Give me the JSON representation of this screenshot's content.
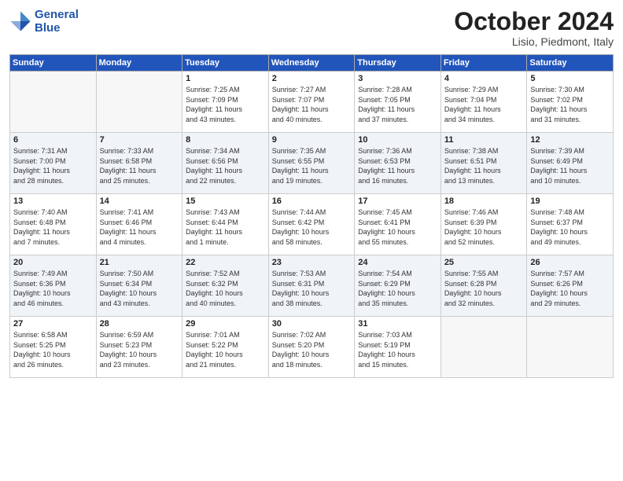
{
  "header": {
    "logo_line1": "General",
    "logo_line2": "Blue",
    "month": "October 2024",
    "location": "Lisio, Piedmont, Italy"
  },
  "weekdays": [
    "Sunday",
    "Monday",
    "Tuesday",
    "Wednesday",
    "Thursday",
    "Friday",
    "Saturday"
  ],
  "weeks": [
    [
      {
        "day": "",
        "info": ""
      },
      {
        "day": "",
        "info": ""
      },
      {
        "day": "1",
        "info": "Sunrise: 7:25 AM\nSunset: 7:09 PM\nDaylight: 11 hours\nand 43 minutes."
      },
      {
        "day": "2",
        "info": "Sunrise: 7:27 AM\nSunset: 7:07 PM\nDaylight: 11 hours\nand 40 minutes."
      },
      {
        "day": "3",
        "info": "Sunrise: 7:28 AM\nSunset: 7:05 PM\nDaylight: 11 hours\nand 37 minutes."
      },
      {
        "day": "4",
        "info": "Sunrise: 7:29 AM\nSunset: 7:04 PM\nDaylight: 11 hours\nand 34 minutes."
      },
      {
        "day": "5",
        "info": "Sunrise: 7:30 AM\nSunset: 7:02 PM\nDaylight: 11 hours\nand 31 minutes."
      }
    ],
    [
      {
        "day": "6",
        "info": "Sunrise: 7:31 AM\nSunset: 7:00 PM\nDaylight: 11 hours\nand 28 minutes."
      },
      {
        "day": "7",
        "info": "Sunrise: 7:33 AM\nSunset: 6:58 PM\nDaylight: 11 hours\nand 25 minutes."
      },
      {
        "day": "8",
        "info": "Sunrise: 7:34 AM\nSunset: 6:56 PM\nDaylight: 11 hours\nand 22 minutes."
      },
      {
        "day": "9",
        "info": "Sunrise: 7:35 AM\nSunset: 6:55 PM\nDaylight: 11 hours\nand 19 minutes."
      },
      {
        "day": "10",
        "info": "Sunrise: 7:36 AM\nSunset: 6:53 PM\nDaylight: 11 hours\nand 16 minutes."
      },
      {
        "day": "11",
        "info": "Sunrise: 7:38 AM\nSunset: 6:51 PM\nDaylight: 11 hours\nand 13 minutes."
      },
      {
        "day": "12",
        "info": "Sunrise: 7:39 AM\nSunset: 6:49 PM\nDaylight: 11 hours\nand 10 minutes."
      }
    ],
    [
      {
        "day": "13",
        "info": "Sunrise: 7:40 AM\nSunset: 6:48 PM\nDaylight: 11 hours\nand 7 minutes."
      },
      {
        "day": "14",
        "info": "Sunrise: 7:41 AM\nSunset: 6:46 PM\nDaylight: 11 hours\nand 4 minutes."
      },
      {
        "day": "15",
        "info": "Sunrise: 7:43 AM\nSunset: 6:44 PM\nDaylight: 11 hours\nand 1 minute."
      },
      {
        "day": "16",
        "info": "Sunrise: 7:44 AM\nSunset: 6:42 PM\nDaylight: 10 hours\nand 58 minutes."
      },
      {
        "day": "17",
        "info": "Sunrise: 7:45 AM\nSunset: 6:41 PM\nDaylight: 10 hours\nand 55 minutes."
      },
      {
        "day": "18",
        "info": "Sunrise: 7:46 AM\nSunset: 6:39 PM\nDaylight: 10 hours\nand 52 minutes."
      },
      {
        "day": "19",
        "info": "Sunrise: 7:48 AM\nSunset: 6:37 PM\nDaylight: 10 hours\nand 49 minutes."
      }
    ],
    [
      {
        "day": "20",
        "info": "Sunrise: 7:49 AM\nSunset: 6:36 PM\nDaylight: 10 hours\nand 46 minutes."
      },
      {
        "day": "21",
        "info": "Sunrise: 7:50 AM\nSunset: 6:34 PM\nDaylight: 10 hours\nand 43 minutes."
      },
      {
        "day": "22",
        "info": "Sunrise: 7:52 AM\nSunset: 6:32 PM\nDaylight: 10 hours\nand 40 minutes."
      },
      {
        "day": "23",
        "info": "Sunrise: 7:53 AM\nSunset: 6:31 PM\nDaylight: 10 hours\nand 38 minutes."
      },
      {
        "day": "24",
        "info": "Sunrise: 7:54 AM\nSunset: 6:29 PM\nDaylight: 10 hours\nand 35 minutes."
      },
      {
        "day": "25",
        "info": "Sunrise: 7:55 AM\nSunset: 6:28 PM\nDaylight: 10 hours\nand 32 minutes."
      },
      {
        "day": "26",
        "info": "Sunrise: 7:57 AM\nSunset: 6:26 PM\nDaylight: 10 hours\nand 29 minutes."
      }
    ],
    [
      {
        "day": "27",
        "info": "Sunrise: 6:58 AM\nSunset: 5:25 PM\nDaylight: 10 hours\nand 26 minutes."
      },
      {
        "day": "28",
        "info": "Sunrise: 6:59 AM\nSunset: 5:23 PM\nDaylight: 10 hours\nand 23 minutes."
      },
      {
        "day": "29",
        "info": "Sunrise: 7:01 AM\nSunset: 5:22 PM\nDaylight: 10 hours\nand 21 minutes."
      },
      {
        "day": "30",
        "info": "Sunrise: 7:02 AM\nSunset: 5:20 PM\nDaylight: 10 hours\nand 18 minutes."
      },
      {
        "day": "31",
        "info": "Sunrise: 7:03 AM\nSunset: 5:19 PM\nDaylight: 10 hours\nand 15 minutes."
      },
      {
        "day": "",
        "info": ""
      },
      {
        "day": "",
        "info": ""
      }
    ]
  ]
}
